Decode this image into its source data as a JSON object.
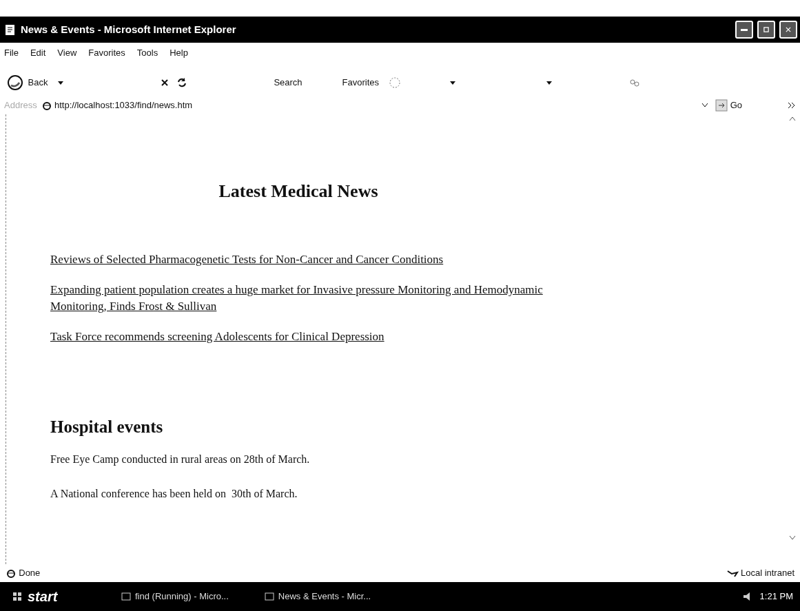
{
  "window": {
    "title": "News & Events - Microsoft Internet Explorer"
  },
  "menu": [
    "File",
    "Edit",
    "View",
    "Favorites",
    "Tools",
    "Help"
  ],
  "toolbar": {
    "back": "Back",
    "search": "Search",
    "favorites": "Favorites"
  },
  "address": {
    "label": "Address",
    "value": "http://localhost:1033/find/news.htm",
    "go": "Go"
  },
  "page": {
    "news_heading": "Latest Medical News",
    "news": [
      "Reviews of Selected Pharmacogenetic Tests for Non-Cancer and Cancer Conditions",
      "Expanding patient population creates a huge market for Invasive pressure Monitoring and Hemodynamic Monitoring, Finds Frost & Sullivan",
      "Task Force recommends screening Adolescents for Clinical Depression"
    ],
    "events_heading": "Hospital events",
    "events": [
      "Free Eye Camp conducted in rural areas on 28th of March.",
      "A National conference has been held on  30th of March."
    ]
  },
  "status_bar": {
    "text": "Done",
    "zone": "Local intranet"
  },
  "taskbar": {
    "start": "start",
    "tasks": [
      "find (Running) - Micro...",
      "News & Events - Micr..."
    ],
    "clock": "1:21 PM"
  }
}
